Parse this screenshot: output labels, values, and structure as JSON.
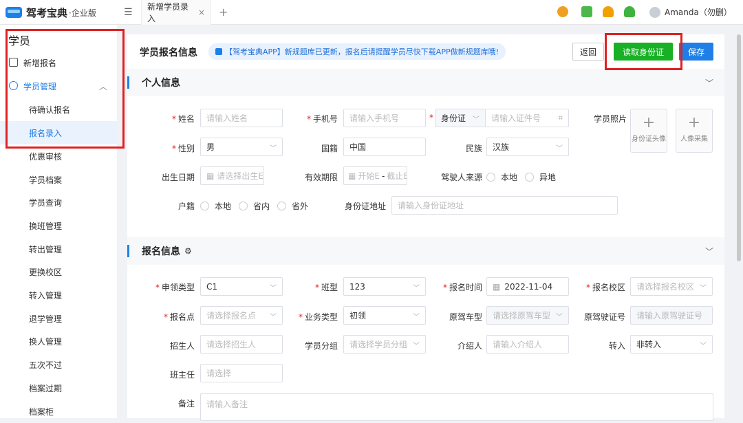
{
  "topbar": {
    "brand": "驾考宝典",
    "edition": "·企业版",
    "tab_label": "新增学员录入",
    "tab_close": "×",
    "tab_add": "+",
    "user_name": "Amanda（勿删）",
    "icons": [
      "person-icon",
      "keyboard-icon",
      "upload-person-icon",
      "bell-icon",
      "avatar"
    ]
  },
  "sidebar": {
    "title": "学员",
    "items": [
      {
        "label": "新增报名"
      },
      {
        "label": "学员管理",
        "expanded": true
      },
      {
        "label": "待确认报名"
      },
      {
        "label": "报名录入",
        "active": true
      },
      {
        "label": "优惠审核"
      },
      {
        "label": "学员档案"
      },
      {
        "label": "学员查询"
      },
      {
        "label": "换班管理"
      },
      {
        "label": "转出管理"
      },
      {
        "label": "更换校区"
      },
      {
        "label": "转入管理"
      },
      {
        "label": "退学管理"
      },
      {
        "label": "换人管理"
      },
      {
        "label": "五次不过"
      },
      {
        "label": "档案过期"
      },
      {
        "label": "档案柜"
      }
    ]
  },
  "main": {
    "title": "学员报名信息",
    "notice": "【驾考宝典APP】新规题库已更新，报名后请提醒学员尽快下载APP做新规题库哦!",
    "back_label": "返回",
    "read_id_label": "读取身份证",
    "save_label": "保存",
    "personal_section": "个人信息",
    "enroll_section": "报名信息",
    "personal": {
      "name_label": "姓名",
      "name_ph": "请输入姓名",
      "phone_label": "手机号",
      "phone_ph": "请输入手机号",
      "idtype_value": "身份证",
      "idno_ph": "请输入证件号",
      "photo_label": "学员照片",
      "photo1_label": "身份证头像",
      "photo2_label": "人像采集",
      "gender_label": "性别",
      "gender_value": "男",
      "nationality_label": "国籍",
      "nationality_value": "中国",
      "ethnicity_label": "民族",
      "ethnicity_value": "汉族",
      "birth_label": "出生日期",
      "birth_ph": "请选择出生E",
      "valid_label": "有效期限",
      "valid_start_ph": "开始E",
      "valid_sep": "-",
      "valid_end_ph": "截止E",
      "source_label": "驾驶人来源",
      "source_opt1": "本地",
      "source_opt2": "异地",
      "hukou_label": "户籍",
      "hukou_opt1": "本地",
      "hukou_opt2": "省内",
      "hukou_opt3": "省外",
      "address_label": "身份证地址",
      "address_ph": "请输入身份证地址"
    },
    "enroll": {
      "license_label": "申领类型",
      "license_value": "C1",
      "class_label": "班型",
      "class_value": "123",
      "time_label": "报名时间",
      "time_value": "2022-11-04",
      "campus_label": "报名校区",
      "campus_ph": "请选择报名校区",
      "point_label": "报名点",
      "point_ph": "请选择报名点",
      "biz_label": "业务类型",
      "biz_value": "初领",
      "origcar_label": "原驾车型",
      "origcar_ph": "请选择原驾车型",
      "origlic_label": "原驾驶证号",
      "origlic_ph": "请输入原驾驶证号",
      "recruiter_label": "招生人",
      "recruiter_ph": "请选择招生人",
      "group_label": "学员分组",
      "group_ph": "请选择学员分组",
      "referrer_label": "介绍人",
      "referrer_ph": "请输入介绍人",
      "transfer_label": "转入",
      "transfer_value": "非转入",
      "headteacher_label": "班主任",
      "headteacher_ph": "请选择",
      "remark_label": "备注",
      "remark_ph": "请输入备注"
    }
  },
  "colors": {
    "accent": "#1f7fe6",
    "green": "#18b024",
    "highlight": "#e02020"
  }
}
